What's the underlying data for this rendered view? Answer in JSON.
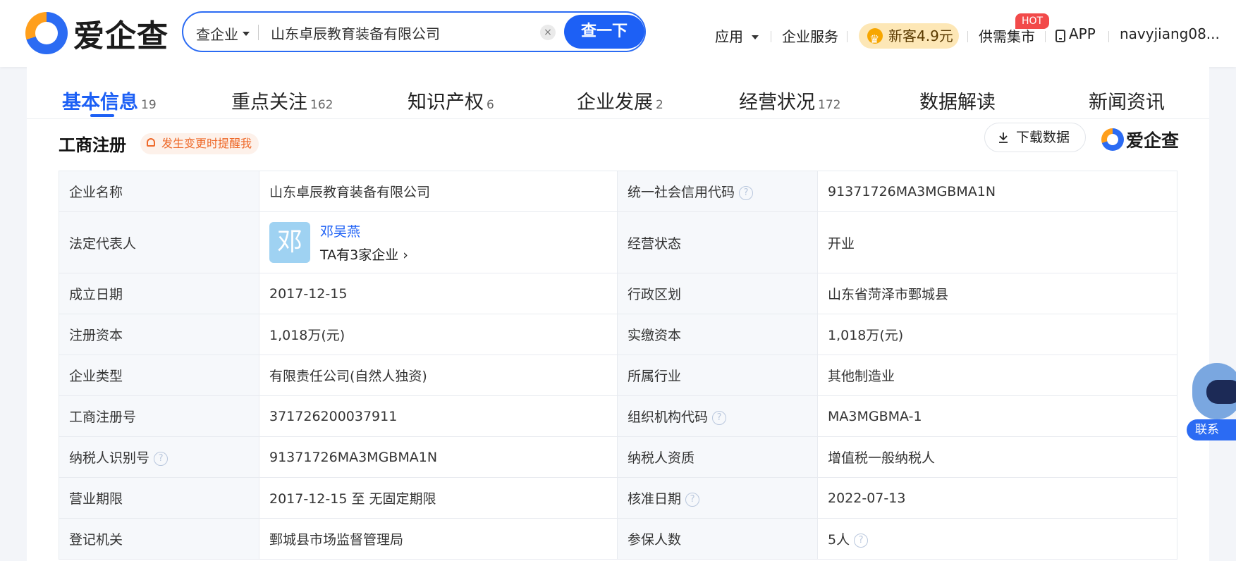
{
  "header": {
    "logo_text": "爱企查",
    "search": {
      "type_label": "查企业",
      "query": "山东卓辰教育装备有限公司",
      "clear": "×",
      "button": "查一下"
    },
    "nav": {
      "apps": "应用",
      "services": "企业服务",
      "promo": "新客4.9元",
      "market": "供需集市",
      "hot_badge": "HOT",
      "app": "APP",
      "user": "navyjiang08..."
    }
  },
  "tabs": [
    {
      "label": "基本信息",
      "count": "19"
    },
    {
      "label": "重点关注",
      "count": "162"
    },
    {
      "label": "知识产权",
      "count": "6"
    },
    {
      "label": "企业发展",
      "count": "2"
    },
    {
      "label": "经营状况",
      "count": "172"
    },
    {
      "label": "数据解读",
      "count": ""
    },
    {
      "label": "新闻资讯",
      "count": ""
    }
  ],
  "section": {
    "title": "工商注册",
    "reminder": "发生变更时提醒我",
    "download": "下载数据",
    "mini_logo": "爱企查"
  },
  "table": {
    "r0": {
      "l1": "企业名称",
      "v1": "山东卓辰教育装备有限公司",
      "l2": "统一社会信用代码",
      "v2": "91371726MA3MGBMA1N"
    },
    "r1": {
      "l1": "法定代表人",
      "avatar": "邓",
      "rep_name": "邓吴燕",
      "rep_count": "TA有3家企业",
      "l2": "经营状态",
      "v2": "开业"
    },
    "r2": {
      "l1": "成立日期",
      "v1": "2017-12-15",
      "l2": "行政区划",
      "v2": "山东省菏泽市鄄城县"
    },
    "r3": {
      "l1": "注册资本",
      "v1": "1,018万(元)",
      "l2": "实缴资本",
      "v2": "1,018万(元)"
    },
    "r4": {
      "l1": "企业类型",
      "v1": "有限责任公司(自然人独资)",
      "l2": "所属行业",
      "v2": "其他制造业"
    },
    "r5": {
      "l1": "工商注册号",
      "v1": "371726200037911",
      "l2": "组织机构代码",
      "v2": "MA3MGBMA-1"
    },
    "r6": {
      "l1": "纳税人识别号",
      "v1": "91371726MA3MGBMA1N",
      "l2": "纳税人资质",
      "v2": "增值税一般纳税人"
    },
    "r7": {
      "l1": "营业期限",
      "v1": "2017-12-15 至 无固定期限",
      "l2": "核准日期",
      "v2": "2022-07-13"
    },
    "r8": {
      "l1": "登记机关",
      "v1": "鄄城县市场监督管理局",
      "l2": "参保人数",
      "v2": "5人"
    }
  },
  "floating": {
    "contact": "联系"
  },
  "colors": {
    "brand_blue": "#1d60f5",
    "accent_orange": "#ff9f1c",
    "hot_red": "#f24a4a"
  }
}
